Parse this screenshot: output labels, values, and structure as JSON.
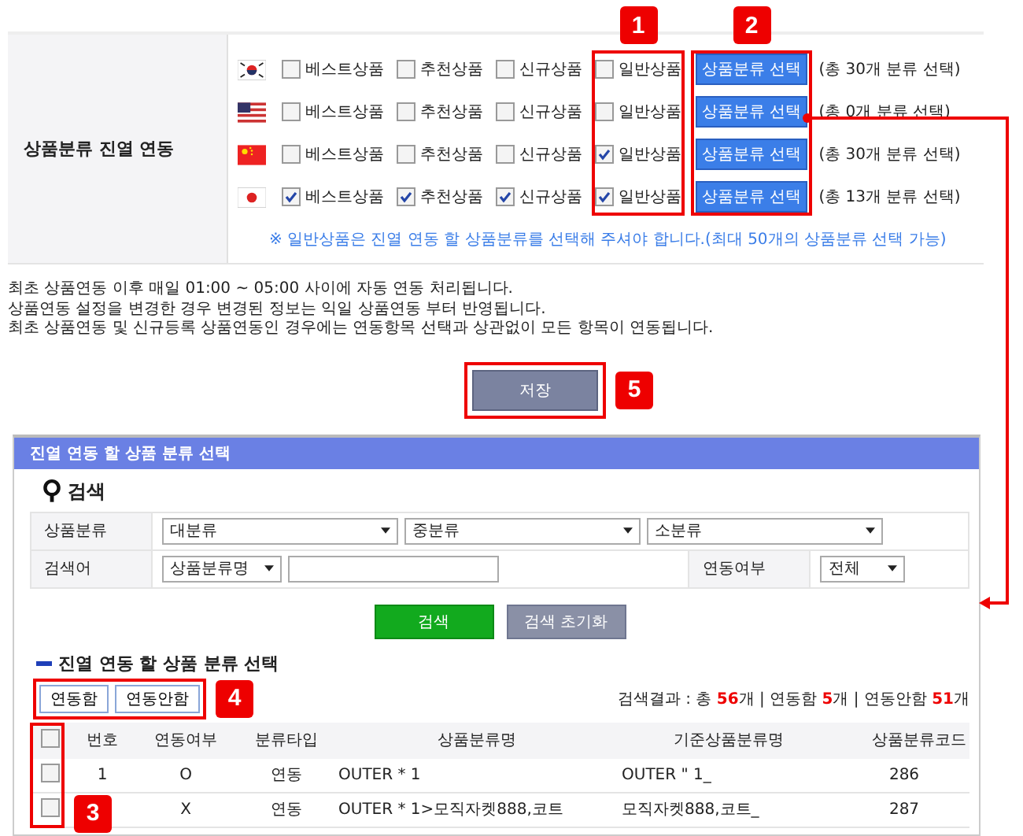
{
  "settings": {
    "label": "상품분류 진열 연동",
    "rows": [
      {
        "kind": "kr",
        "options": [
          {
            "label": "베스트상품",
            "checked": false
          },
          {
            "label": "추천상품",
            "checked": false
          },
          {
            "label": "신규상품",
            "checked": false
          },
          {
            "label": "일반상품",
            "checked": false
          }
        ],
        "button": "상품분류 선택",
        "count": "(총 30개 분류 선택)"
      },
      {
        "kind": "us",
        "options": [
          {
            "label": "베스트상품",
            "checked": false
          },
          {
            "label": "추천상품",
            "checked": false
          },
          {
            "label": "신규상품",
            "checked": false
          },
          {
            "label": "일반상품",
            "checked": false
          }
        ],
        "button": "상품분류 선택",
        "count": "(총 0개 분류 선택)"
      },
      {
        "kind": "cn",
        "options": [
          {
            "label": "베스트상품",
            "checked": false
          },
          {
            "label": "추천상품",
            "checked": false
          },
          {
            "label": "신규상품",
            "checked": false
          },
          {
            "label": "일반상품",
            "checked": true
          }
        ],
        "button": "상품분류 선택",
        "count": "(총 30개 분류 선택)"
      },
      {
        "kind": "jp",
        "options": [
          {
            "label": "베스트상품",
            "checked": true
          },
          {
            "label": "추천상품",
            "checked": true
          },
          {
            "label": "신규상품",
            "checked": true
          },
          {
            "label": "일반상품",
            "checked": true
          }
        ],
        "button": "상품분류 선택",
        "count": "(총 13개 분류 선택)"
      }
    ],
    "note": "※ 일반상품은 진열 연동 할 상품분류를 선택해 주셔야 합니다.(최대 50개의 상품분류 선택 가능)"
  },
  "notes": [
    "최초 상품연동 이후 매일 01:00 ~ 05:00 사이에 자동 연동 처리됩니다.",
    "상품연동 설정을 변경한 경우 변경된 정보는 익일 상품연동 부터 반영됩니다.",
    "최초 상품연동 및 신규등록 상품연동인 경우에는 연동항목 선택과 상관없이 모든 항목이 연동됩니다."
  ],
  "save_button": "저장",
  "callouts": [
    "1",
    "2",
    "3",
    "4",
    "5"
  ],
  "panel": {
    "title": "진열 연동 할 상품 분류 선택",
    "search": {
      "title": "검색",
      "category_label": "상품분류",
      "category_selects": [
        "대분류",
        "중분류",
        "소분류"
      ],
      "keyword_label": "검색어",
      "keyword_select": "상품분류명",
      "link_label": "연동여부",
      "link_select": "전체",
      "search_button": "검색",
      "reset_button": "검색 초기화"
    },
    "list": {
      "title": "진열 연동 할 상품 분류 선택",
      "buttons": [
        "연동함",
        "연동안함"
      ],
      "result": "검색결과 : 총 **56**개 | 연동함 **5**개 | 연동안함 **51**개",
      "columns": [
        "번호",
        "연동여부",
        "분류타입",
        "상품분류명",
        "기준상품분류명",
        "상품분류코드"
      ],
      "header_checked": false,
      "rows": [
        {
          "checked": false,
          "no": "1",
          "linked": "O",
          "type": "연동",
          "name": "OUTER * 1",
          "base": "OUTER \" 1_",
          "code": "286"
        },
        {
          "checked": false,
          "linked": "X",
          "type": "연동",
          "name": "OUTER * 1>모직자켓888,코트",
          "base": "모직자켓888,코트_",
          "code": "287"
        }
      ]
    }
  }
}
